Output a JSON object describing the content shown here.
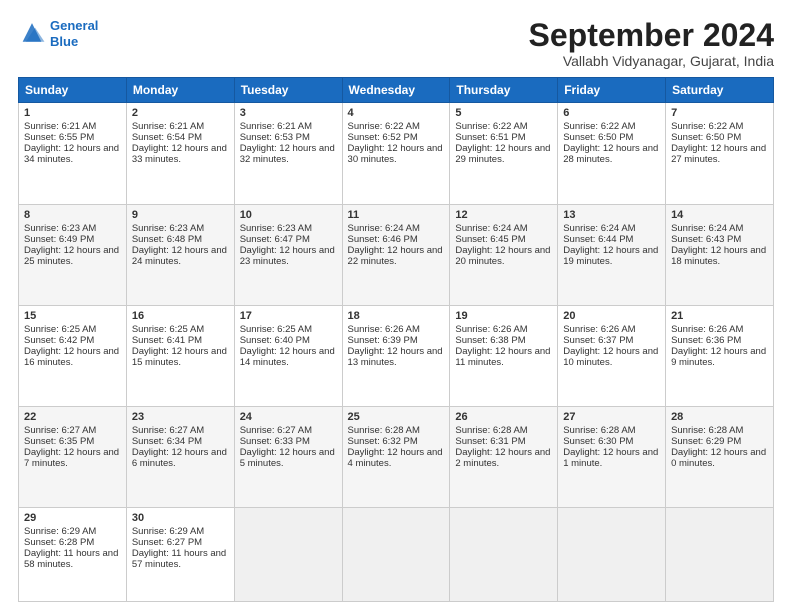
{
  "logo": {
    "line1": "General",
    "line2": "Blue"
  },
  "title": "September 2024",
  "location": "Vallabh Vidyanagar, Gujarat, India",
  "days_header": [
    "Sunday",
    "Monday",
    "Tuesday",
    "Wednesday",
    "Thursday",
    "Friday",
    "Saturday"
  ],
  "weeks": [
    [
      {
        "day": "1",
        "sunrise": "6:21 AM",
        "sunset": "6:55 PM",
        "daylight": "12 hours and 34 minutes."
      },
      {
        "day": "2",
        "sunrise": "6:21 AM",
        "sunset": "6:54 PM",
        "daylight": "12 hours and 33 minutes."
      },
      {
        "day": "3",
        "sunrise": "6:21 AM",
        "sunset": "6:53 PM",
        "daylight": "12 hours and 32 minutes."
      },
      {
        "day": "4",
        "sunrise": "6:22 AM",
        "sunset": "6:52 PM",
        "daylight": "12 hours and 30 minutes."
      },
      {
        "day": "5",
        "sunrise": "6:22 AM",
        "sunset": "6:51 PM",
        "daylight": "12 hours and 29 minutes."
      },
      {
        "day": "6",
        "sunrise": "6:22 AM",
        "sunset": "6:50 PM",
        "daylight": "12 hours and 28 minutes."
      },
      {
        "day": "7",
        "sunrise": "6:22 AM",
        "sunset": "6:50 PM",
        "daylight": "12 hours and 27 minutes."
      }
    ],
    [
      {
        "day": "8",
        "sunrise": "6:23 AM",
        "sunset": "6:49 PM",
        "daylight": "12 hours and 25 minutes."
      },
      {
        "day": "9",
        "sunrise": "6:23 AM",
        "sunset": "6:48 PM",
        "daylight": "12 hours and 24 minutes."
      },
      {
        "day": "10",
        "sunrise": "6:23 AM",
        "sunset": "6:47 PM",
        "daylight": "12 hours and 23 minutes."
      },
      {
        "day": "11",
        "sunrise": "6:24 AM",
        "sunset": "6:46 PM",
        "daylight": "12 hours and 22 minutes."
      },
      {
        "day": "12",
        "sunrise": "6:24 AM",
        "sunset": "6:45 PM",
        "daylight": "12 hours and 20 minutes."
      },
      {
        "day": "13",
        "sunrise": "6:24 AM",
        "sunset": "6:44 PM",
        "daylight": "12 hours and 19 minutes."
      },
      {
        "day": "14",
        "sunrise": "6:24 AM",
        "sunset": "6:43 PM",
        "daylight": "12 hours and 18 minutes."
      }
    ],
    [
      {
        "day": "15",
        "sunrise": "6:25 AM",
        "sunset": "6:42 PM",
        "daylight": "12 hours and 16 minutes."
      },
      {
        "day": "16",
        "sunrise": "6:25 AM",
        "sunset": "6:41 PM",
        "daylight": "12 hours and 15 minutes."
      },
      {
        "day": "17",
        "sunrise": "6:25 AM",
        "sunset": "6:40 PM",
        "daylight": "12 hours and 14 minutes."
      },
      {
        "day": "18",
        "sunrise": "6:26 AM",
        "sunset": "6:39 PM",
        "daylight": "12 hours and 13 minutes."
      },
      {
        "day": "19",
        "sunrise": "6:26 AM",
        "sunset": "6:38 PM",
        "daylight": "12 hours and 11 minutes."
      },
      {
        "day": "20",
        "sunrise": "6:26 AM",
        "sunset": "6:37 PM",
        "daylight": "12 hours and 10 minutes."
      },
      {
        "day": "21",
        "sunrise": "6:26 AM",
        "sunset": "6:36 PM",
        "daylight": "12 hours and 9 minutes."
      }
    ],
    [
      {
        "day": "22",
        "sunrise": "6:27 AM",
        "sunset": "6:35 PM",
        "daylight": "12 hours and 7 minutes."
      },
      {
        "day": "23",
        "sunrise": "6:27 AM",
        "sunset": "6:34 PM",
        "daylight": "12 hours and 6 minutes."
      },
      {
        "day": "24",
        "sunrise": "6:27 AM",
        "sunset": "6:33 PM",
        "daylight": "12 hours and 5 minutes."
      },
      {
        "day": "25",
        "sunrise": "6:28 AM",
        "sunset": "6:32 PM",
        "daylight": "12 hours and 4 minutes."
      },
      {
        "day": "26",
        "sunrise": "6:28 AM",
        "sunset": "6:31 PM",
        "daylight": "12 hours and 2 minutes."
      },
      {
        "day": "27",
        "sunrise": "6:28 AM",
        "sunset": "6:30 PM",
        "daylight": "12 hours and 1 minute."
      },
      {
        "day": "28",
        "sunrise": "6:28 AM",
        "sunset": "6:29 PM",
        "daylight": "12 hours and 0 minutes."
      }
    ],
    [
      {
        "day": "29",
        "sunrise": "6:29 AM",
        "sunset": "6:28 PM",
        "daylight": "11 hours and 58 minutes."
      },
      {
        "day": "30",
        "sunrise": "6:29 AM",
        "sunset": "6:27 PM",
        "daylight": "11 hours and 57 minutes."
      },
      null,
      null,
      null,
      null,
      null
    ]
  ]
}
